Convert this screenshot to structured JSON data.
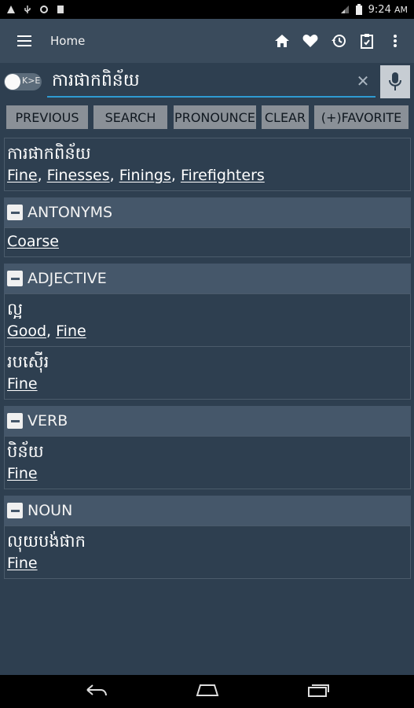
{
  "status_bar": {
    "time": "9:24",
    "ampm": "AM"
  },
  "app_bar": {
    "title": "Home"
  },
  "search": {
    "toggle_label": "K>E",
    "query": "ការផាកពិន័យ"
  },
  "buttons": {
    "previous": "PREVIOUS",
    "search": "SEARCH",
    "pronounce": "PRONOUNCE",
    "clear": "CLEAR",
    "favorite": "(+)FAVORITE"
  },
  "results": {
    "headword": "ការផាកពិន័យ",
    "headword_links": [
      "Fine",
      "Finesses",
      "Finings",
      "Firefighters"
    ],
    "antonyms": {
      "label": "ANTONYMS",
      "links": [
        "Coarse"
      ]
    },
    "adjective": {
      "label": "ADJECTIVE",
      "entries": [
        {
          "khmer": "ល្អ",
          "links": [
            "Good",
            "Fine"
          ]
        },
        {
          "khmer": "របស៊ើរ",
          "links": [
            "Fine"
          ]
        }
      ]
    },
    "verb": {
      "label": "VERB",
      "entries": [
        {
          "khmer": "បិន័យ",
          "links": [
            "Fine"
          ]
        }
      ]
    },
    "noun": {
      "label": "NOUN",
      "entries": [
        {
          "khmer": "លុយបង់ផាក",
          "links": [
            "Fine"
          ]
        }
      ]
    }
  },
  "colors": {
    "background": "#2e3f50",
    "header": "#3a4b5c",
    "section": "#45576a",
    "accent": "#2e9bd2",
    "button": "#8a9097"
  }
}
